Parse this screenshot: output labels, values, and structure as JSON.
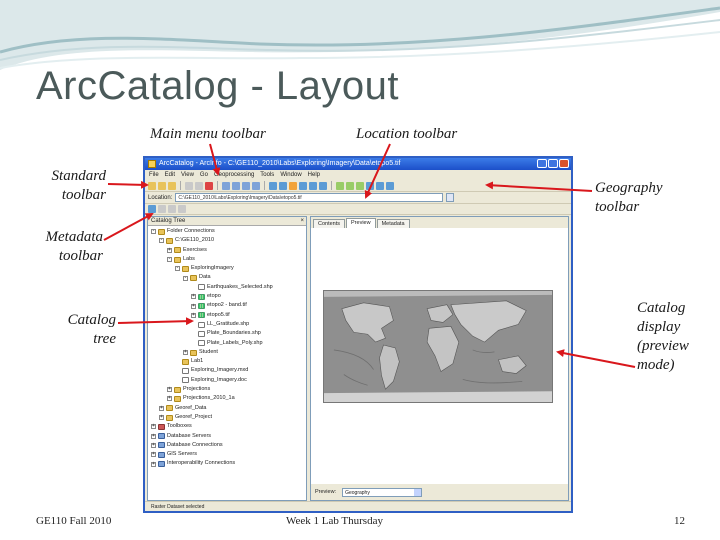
{
  "slide": {
    "title": "ArcCatalog - Layout",
    "footer_left": "GE110 Fall 2010",
    "footer_center": "Week 1 Lab Thursday",
    "page_number": "12"
  },
  "callouts": {
    "main_menu": "Main menu toolbar",
    "location": "Location toolbar",
    "standard": "Standard\ntoolbar",
    "geography": "Geography\ntoolbar",
    "metadata": "Metadata\ntoolbar",
    "catalog_tree": "Catalog\ntree",
    "catalog_display": "Catalog\ndisplay\n(preview\nmode)"
  },
  "colors": {
    "arrow": "#d9171c",
    "title_text": "#4b5a5a",
    "deco_band": "#bcd2d6"
  },
  "screenshot": {
    "window_title": "ArcCatalog - ArcInfo - C:\\GE110_2010\\Labs\\Exploring\\Imagery\\Data\\etopo5.tif",
    "menu": [
      "File",
      "Edit",
      "View",
      "Go",
      "Geoprocessing",
      "Tools",
      "Window",
      "Help"
    ],
    "location_label": "Location:",
    "location_value": "C:\\GE110_2010\\Labs\\Exploring\\Imagery\\Data\\etopo5.tif",
    "tree_header": "Catalog Tree",
    "tree": [
      {
        "label": "Folder Connections",
        "icon": "folder",
        "indent": 0,
        "toggle": "-"
      },
      {
        "label": "C:\\GE110_2010",
        "icon": "folder",
        "indent": 1,
        "toggle": "-"
      },
      {
        "label": "Exercises",
        "icon": "folder",
        "indent": 2,
        "toggle": "+"
      },
      {
        "label": "Labs",
        "icon": "folder",
        "indent": 2,
        "toggle": "-"
      },
      {
        "label": "ExploringImagery",
        "icon": "folder",
        "indent": 3,
        "toggle": "-"
      },
      {
        "label": "Data",
        "icon": "folder",
        "indent": 4,
        "toggle": "-"
      },
      {
        "label": "Earthquakes_Selected.shp",
        "icon": "doc",
        "indent": 5,
        "toggle": ""
      },
      {
        "label": "etopo",
        "icon": "raster",
        "indent": 5,
        "toggle": "+"
      },
      {
        "label": "etopo2 - band.tif",
        "icon": "raster",
        "indent": 5,
        "toggle": "+"
      },
      {
        "label": "etopo5.tif",
        "icon": "raster",
        "indent": 5,
        "toggle": "+"
      },
      {
        "label": "LL_Gratitude.shp",
        "icon": "doc",
        "indent": 5,
        "toggle": ""
      },
      {
        "label": "Plate_Boundaries.shp",
        "icon": "doc",
        "indent": 5,
        "toggle": ""
      },
      {
        "label": "Plate_Labels_Poly.shp",
        "icon": "doc",
        "indent": 5,
        "toggle": ""
      },
      {
        "label": "Student",
        "icon": "folder",
        "indent": 4,
        "toggle": "+"
      },
      {
        "label": "Lab1",
        "icon": "folder",
        "indent": 3,
        "toggle": ""
      },
      {
        "label": "Exploring_Imagery.mxd",
        "icon": "doc",
        "indent": 3,
        "toggle": ""
      },
      {
        "label": "Exploring_Imagery.doc",
        "icon": "doc",
        "indent": 3,
        "toggle": ""
      },
      {
        "label": "Projections",
        "icon": "folder",
        "indent": 2,
        "toggle": "+"
      },
      {
        "label": "Projections_2010_1a",
        "icon": "folder",
        "indent": 2,
        "toggle": "+"
      },
      {
        "label": "Georef_Data",
        "icon": "folder",
        "indent": 1,
        "toggle": "+"
      },
      {
        "label": "Georef_Project",
        "icon": "folder",
        "indent": 1,
        "toggle": "+"
      },
      {
        "label": "Toolboxes",
        "icon": "tool",
        "indent": 0,
        "toggle": "+"
      },
      {
        "label": "Database Servers",
        "icon": "db",
        "indent": 0,
        "toggle": "+"
      },
      {
        "label": "Database Connections",
        "icon": "db",
        "indent": 0,
        "toggle": "+"
      },
      {
        "label": "GIS Servers",
        "icon": "db",
        "indent": 0,
        "toggle": "+"
      },
      {
        "label": "Interoperability Connections",
        "icon": "db",
        "indent": 0,
        "toggle": "+"
      }
    ],
    "tabs": [
      "Contents",
      "Preview",
      "Metadata"
    ],
    "active_tab": "Preview",
    "preview_label": "Preview:",
    "preview_value": "Geography",
    "status": "Raster Dataset selected"
  }
}
